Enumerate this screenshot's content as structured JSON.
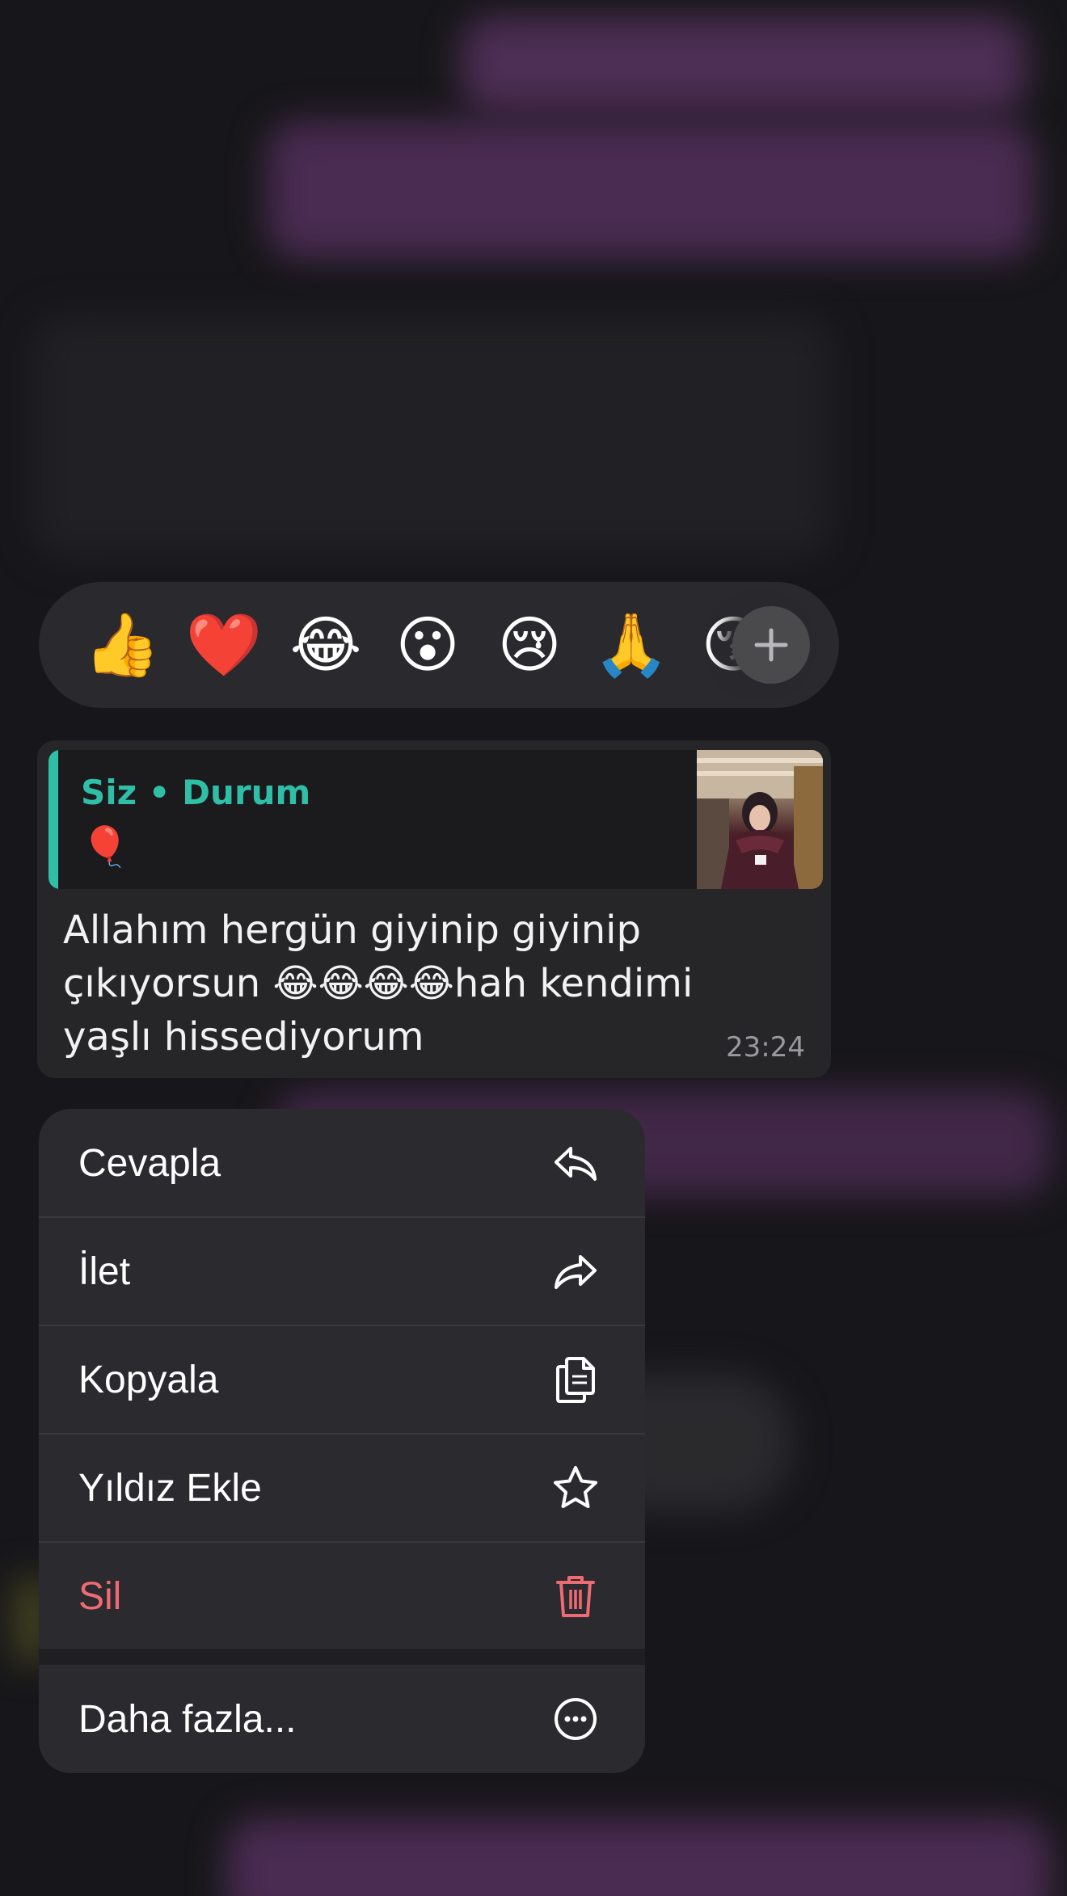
{
  "reactions": {
    "emojis": [
      "👍",
      "❤️",
      "😂",
      "😮",
      "😢",
      "🙏",
      "😚"
    ],
    "more_icon": "plus-icon"
  },
  "message": {
    "quote_title": "Siz • Durum",
    "quote_emoji": "🎈",
    "text": "Allahım hergün giyinip giyinip çıkıyorsun 😂😂😂😂hah kendimi yaşlı hissediyorum",
    "time": "23:24"
  },
  "menu": {
    "items": [
      {
        "label": "Cevapla",
        "icon": "reply-icon"
      },
      {
        "label": "İlet",
        "icon": "forward-icon"
      },
      {
        "label": "Kopyala",
        "icon": "copy-icon"
      },
      {
        "label": "Yıldız Ekle",
        "icon": "star-icon"
      },
      {
        "label": "Sil",
        "icon": "trash-icon"
      }
    ],
    "more": {
      "label": "Daha fazla...",
      "icon": "ellipsis-circle-icon"
    }
  },
  "colors": {
    "accent": "#2fbfa7",
    "danger": "#ee6b74",
    "menu_bg": "#2b2a2e",
    "bubble_bg": "#262528"
  }
}
